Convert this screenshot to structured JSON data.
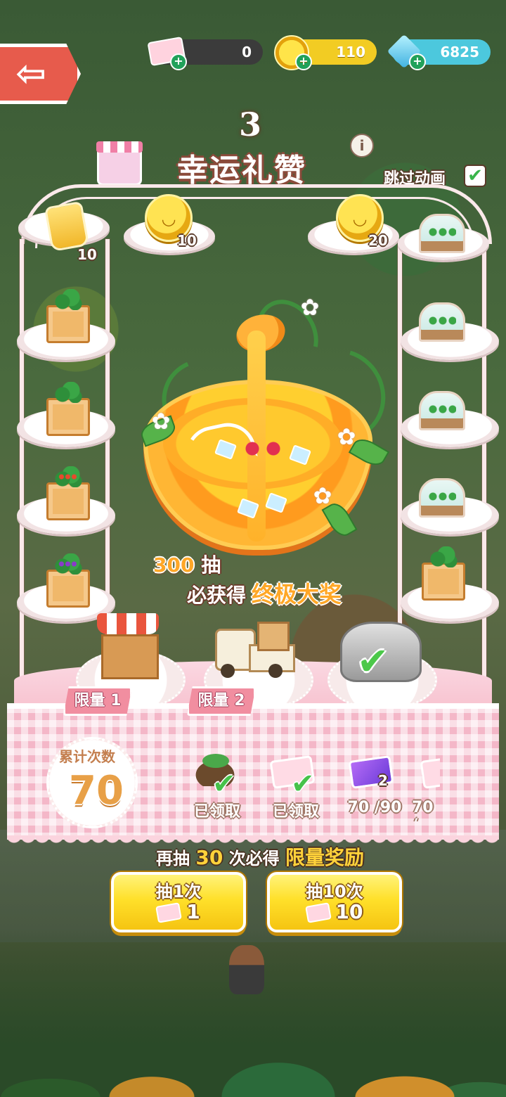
{
  "resources": {
    "tickets": "0",
    "coins": "110",
    "gems": "6825",
    "plus_symbol": "+"
  },
  "nav": {
    "back_symbol": "⇦"
  },
  "header": {
    "round_number": "3",
    "title": "幸运礼赞",
    "info_symbol": "i",
    "skip_label": "跳过动画",
    "skip_checked_symbol": "✔"
  },
  "pool_items": {
    "top": [
      {
        "icon": "coin-bag-icon",
        "qty": "10"
      },
      {
        "icon": "coin-icon",
        "qty": "10"
      },
      {
        "icon": "coin-icon",
        "qty": "20"
      }
    ],
    "left": [
      "crate-of-greens",
      "crate-of-cabbage",
      "crate-of-orange-tree",
      "crate-of-eggplant"
    ],
    "right": [
      "greenhouse",
      "greenhouse",
      "greenhouse",
      "greenhouse",
      "crate-of-plant"
    ]
  },
  "grand_prize": {
    "count": "300",
    "count_unit": "抽",
    "guarantee_text": "必获得",
    "prize_name": "终极大奖",
    "flower_symbol": "✿"
  },
  "limited": [
    {
      "label": "限量",
      "num": "1",
      "item": "market-stall"
    },
    {
      "label": "限量",
      "num": "2",
      "item": "delivery-truck"
    },
    {
      "item": "grey-locomotive",
      "owned": true,
      "check_symbol": "✔"
    }
  ],
  "progress": {
    "label": "累计次数",
    "value": "70",
    "milestones": [
      {
        "icon": "plant-pot-icon",
        "status": "已领取",
        "check_symbol": "✔"
      },
      {
        "icon": "ticket-icon",
        "status": "已领取",
        "check_symbol": "✔"
      },
      {
        "icon": "video-ticket-icon",
        "qty": "2",
        "status": "70 /90"
      },
      {
        "icon": "ticket-icon",
        "status": "70 /"
      }
    ]
  },
  "next_reward": {
    "prefix": "再抽",
    "count": "30",
    "middle": "次必得",
    "reward": "限量奖励"
  },
  "buttons": {
    "draw1": {
      "label": "抽1次",
      "cost": "1"
    },
    "draw10": {
      "label": "抽10次",
      "cost": "10"
    }
  },
  "colors": {
    "accent_orange": "#ffa727",
    "button_yellow": "#ffe02a",
    "tablecloth_pink": "#f4b7c8",
    "check_green": "#46c24a"
  }
}
